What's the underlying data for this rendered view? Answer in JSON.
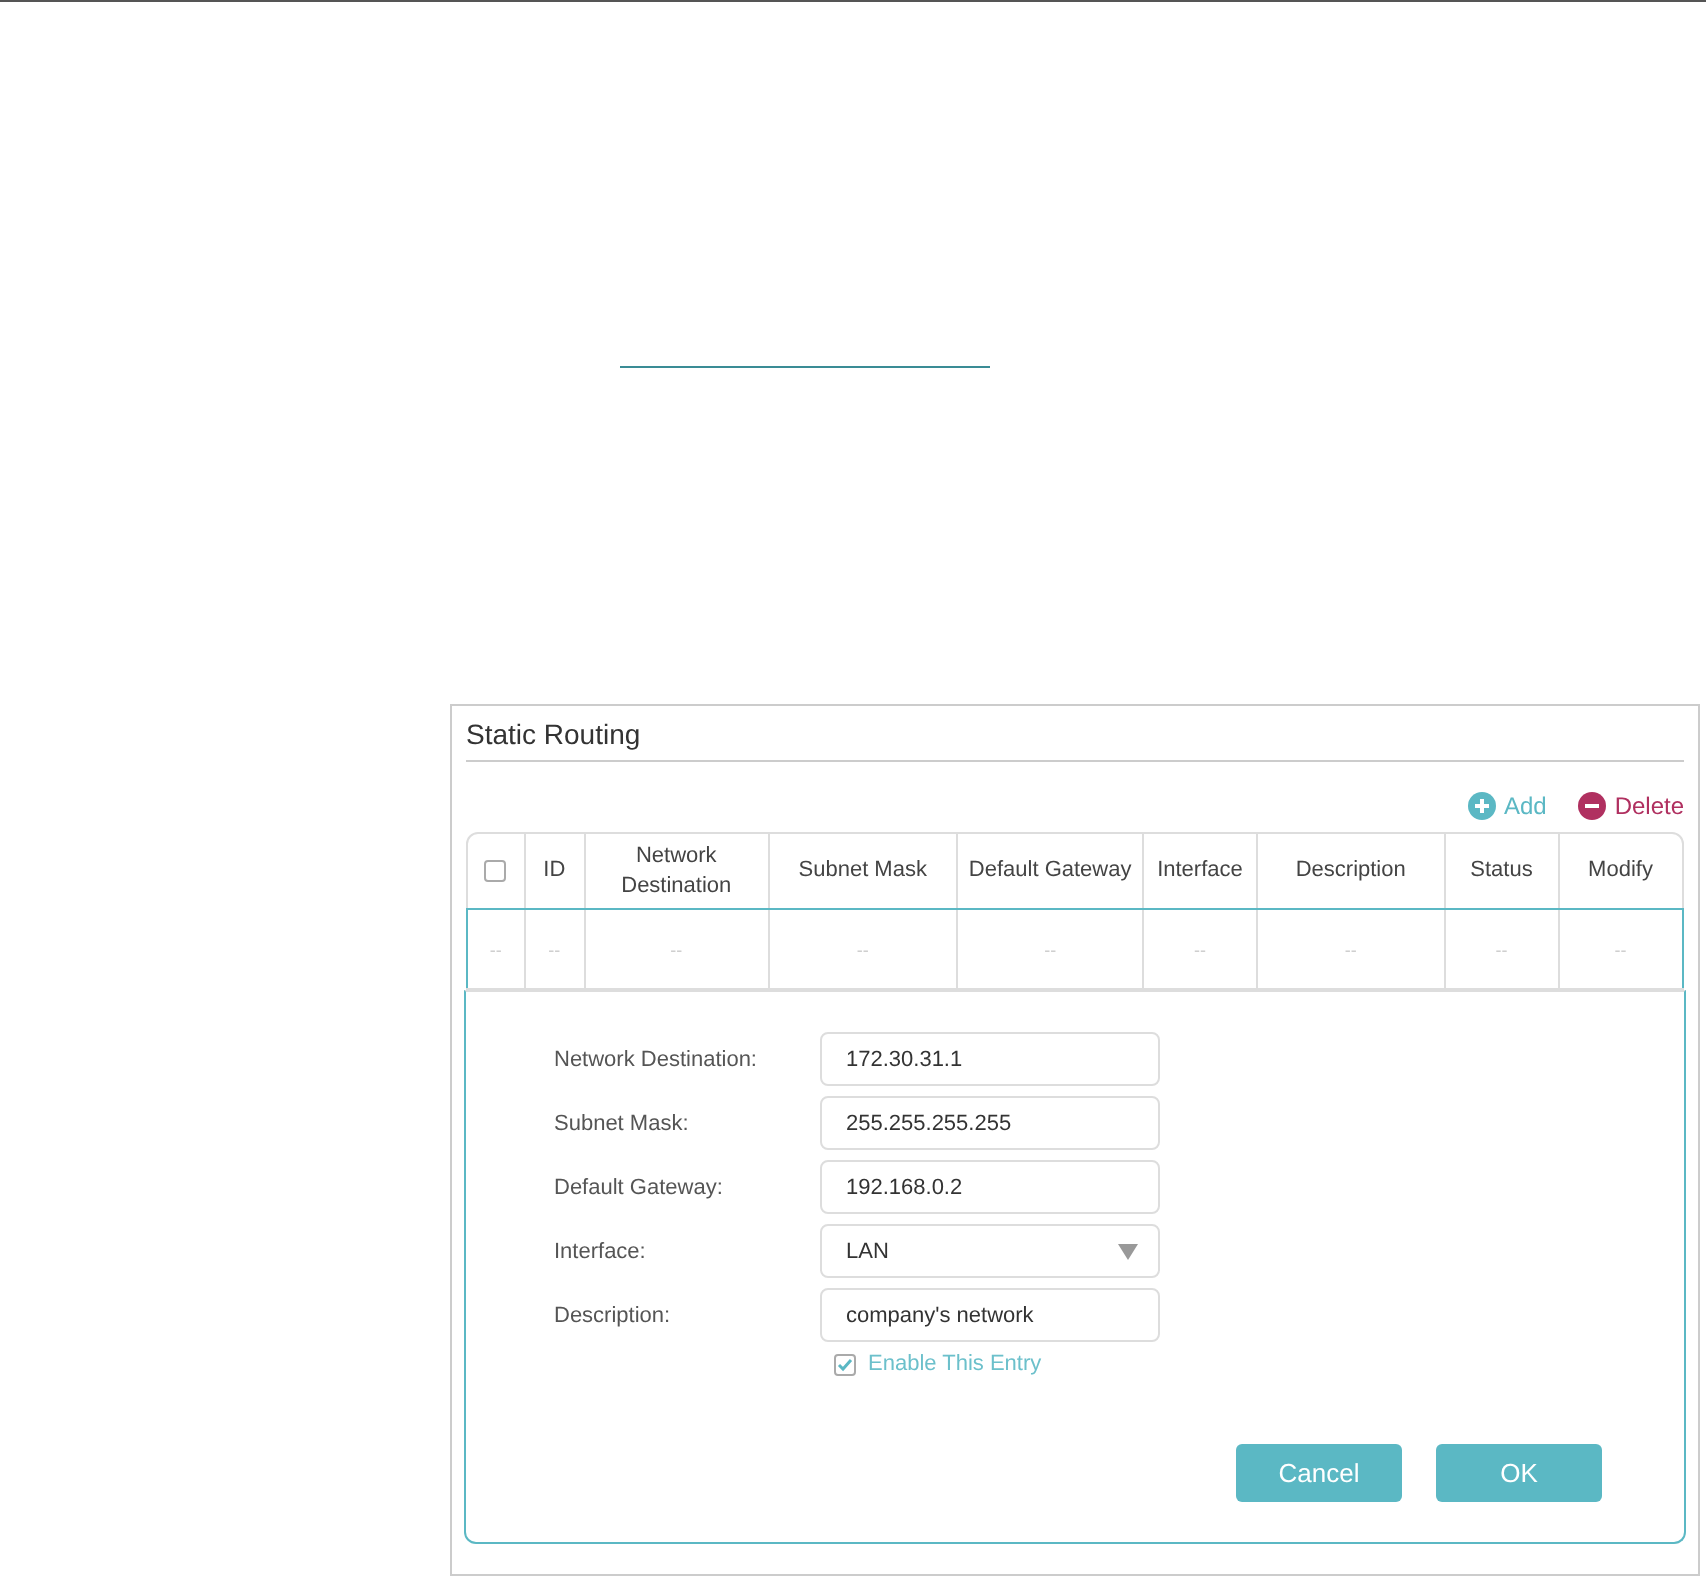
{
  "panel": {
    "title": "Static Routing"
  },
  "actions": [
    {
      "kind": "add",
      "label": "Add"
    },
    {
      "kind": "delete",
      "label": "Delete"
    }
  ],
  "table": {
    "columns": [
      {
        "kind": "checkbox",
        "checked": false
      },
      {
        "kind": "text",
        "label": "ID"
      },
      {
        "kind": "text",
        "label": "Network Destination"
      },
      {
        "kind": "text",
        "label": "Subnet Mask"
      },
      {
        "kind": "text",
        "label": "Default Gateway"
      },
      {
        "kind": "text",
        "label": "Interface"
      },
      {
        "kind": "text",
        "label": "Description"
      },
      {
        "kind": "text",
        "label": "Status"
      },
      {
        "kind": "text",
        "label": "Modify"
      }
    ],
    "rows": [
      {
        "cells": [
          "--",
          "--",
          "--",
          "--",
          "--",
          "--",
          "--",
          "--",
          "--"
        ]
      }
    ]
  },
  "form": {
    "fields": [
      {
        "kind": "text",
        "label": "Network Destination:",
        "value": "172.30.31.1"
      },
      {
        "kind": "text",
        "label": "Subnet Mask:",
        "value": "255.255.255.255"
      },
      {
        "kind": "text",
        "label": "Default Gateway:",
        "value": "192.168.0.2"
      },
      {
        "kind": "select",
        "label": "Interface:",
        "value": "LAN"
      },
      {
        "kind": "text",
        "label": "Description:",
        "value": "company's network"
      }
    ],
    "enable": {
      "label": "Enable This Entry",
      "checked": true
    },
    "buttons": [
      "Cancel",
      "OK"
    ]
  }
}
